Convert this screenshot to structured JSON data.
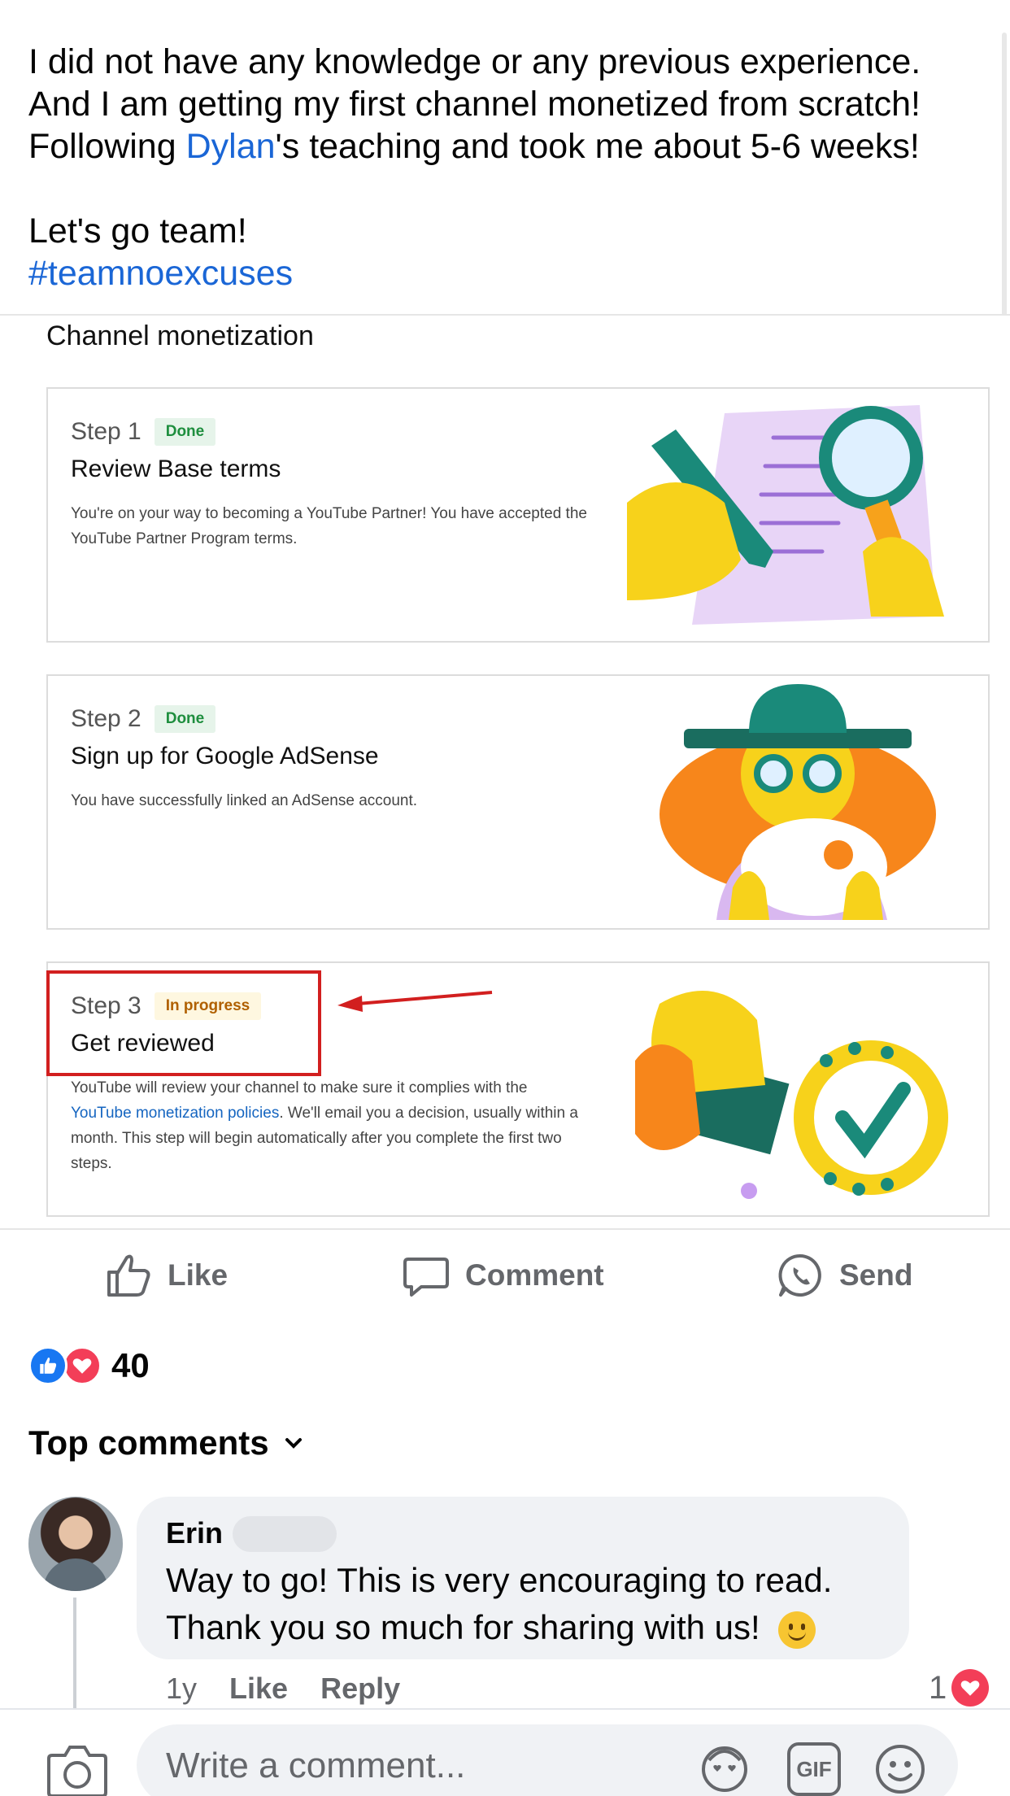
{
  "post": {
    "lines": [
      "I did not have any knowledge or any previous experience.",
      "And I am getting my first channel monetized from scratch!"
    ],
    "line3_prefix": "Following ",
    "line3_link": "Dylan",
    "line3_suffix": "'s teaching and took me about 5-6 weeks!",
    "cheer": "Let's go team!",
    "hashtag": "#teamnoexcuses"
  },
  "embed": {
    "title": "Channel monetization",
    "steps": [
      {
        "step": "Step 1",
        "badge": "Done",
        "title": "Review Base terms",
        "desc": "You're on your way to becoming a YouTube Partner! You have accepted the YouTube Partner Program terms."
      },
      {
        "step": "Step 2",
        "badge": "Done",
        "title": "Sign up for Google AdSense",
        "desc": "You have successfully linked an AdSense account."
      },
      {
        "step": "Step 3",
        "badge": "In progress",
        "title": "Get reviewed",
        "desc_prefix": "YouTube will review your channel to make sure it complies with the ",
        "desc_link": "YouTube monetization policies",
        "desc_suffix": ". We'll email you a decision, usually within a month. This step will begin automatically after you complete the first two steps."
      }
    ]
  },
  "actions": {
    "like": "Like",
    "comment": "Comment",
    "send": "Send"
  },
  "reactions": {
    "count": "40"
  },
  "comments_header": "Top comments",
  "comment": {
    "author": "Erin",
    "line1": "Way to go!  This is very encouraging to read.",
    "line2": "Thank you so much for sharing with us!",
    "time": "1y",
    "like": "Like",
    "reply": "Reply",
    "reaction_count": "1"
  },
  "composer": {
    "placeholder": "Write a comment...",
    "gif": "GIF"
  },
  "colors": {
    "link": "#1a66d6",
    "facebook_blue": "#1877f2",
    "love_red": "#f33e58",
    "highlight_red": "#d21f1f"
  }
}
